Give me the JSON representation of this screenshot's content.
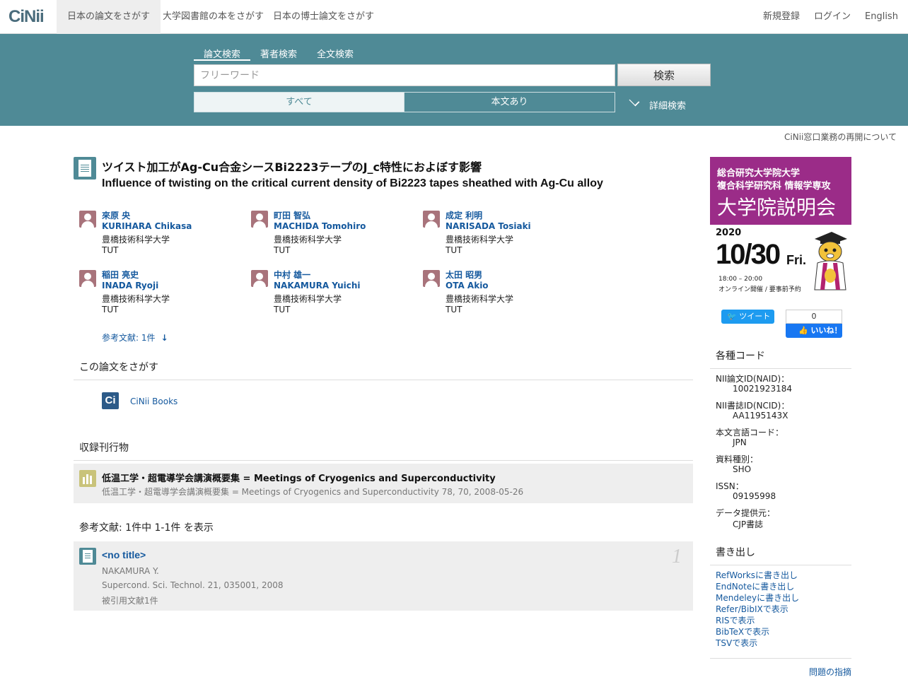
{
  "nav": {
    "logo_ci": "Ci",
    "logo_nii": "Nii",
    "tabs": [
      "日本の論文をさがす",
      "大学図書館の本をさがす",
      "日本の博士論文をさがす"
    ],
    "register": "新規登録",
    "login": "ログイン",
    "english": "English"
  },
  "search": {
    "tabs": [
      "論文検索",
      "著者検索",
      "全文検索"
    ],
    "placeholder": "フリーワード",
    "button": "検索",
    "filter_all": "すべて",
    "filter_body": "本文あり",
    "advanced": "詳細検索"
  },
  "notice": "CiNii窓口業務の再開について",
  "article": {
    "title_ja": "ツイスト加工がAg-Cu合金シースBi2223テープのJ_c特性におよぼす影響",
    "title_en": "Influence of twisting on the critical current density of Bi2223 tapes sheathed with Ag-Cu alloy",
    "authors": [
      {
        "ja": "來原 央",
        "en": "KURIHARA Chikasa",
        "aff_ja": "豊橋技術科学大学",
        "aff_en": "TUT"
      },
      {
        "ja": "町田 智弘",
        "en": "MACHIDA Tomohiro",
        "aff_ja": "豊橋技術科学大学",
        "aff_en": "TUT"
      },
      {
        "ja": "成定 利明",
        "en": "NARISADA Tosiaki",
        "aff_ja": "豊橋技術科学大学",
        "aff_en": "TUT"
      },
      {
        "ja": "稲田 亮史",
        "en": "INADA Ryoji",
        "aff_ja": "豊橋技術科学大学",
        "aff_en": "TUT"
      },
      {
        "ja": "中村 雄一",
        "en": "NAKAMURA Yuichi",
        "aff_ja": "豊橋技術科学大学",
        "aff_en": "TUT"
      },
      {
        "ja": "太田 昭男",
        "en": "OTA Akio",
        "aff_ja": "豊橋技術科学大学",
        "aff_en": "TUT"
      }
    ],
    "refs_link": "参考文献: 1件",
    "search_this_heading": "この論文をさがす",
    "cinii_books_icon": "Ci",
    "cinii_books": "CiNii Books",
    "journal_heading": "収録刊行物",
    "journal_title": "低温工学・超電導学会講演概要集 = Meetings of Cryogenics and Superconductivity",
    "journal_sub": "低温工学・超電導学会講演概要集 = Meetings of Cryogenics and Superconductivity 78, 70, 2008-05-26",
    "refs_heading": "参考文献:  1件中 1-1件 を表示",
    "ref": {
      "title": "<no title>",
      "num": "1",
      "author": "NAKAMURA Y.",
      "source": "Supercond. Sci. Technol. 21, 035001, 2008",
      "cited": "被引用文献1件"
    }
  },
  "banner": {
    "line1": "総合研究大学院大学",
    "line2": "複合科学研究科 情報学専攻",
    "line3": "大学院説明会",
    "year": "2020",
    "date": "10/30",
    "dow": "Fri.",
    "time": "18:00 – 20:00",
    "online": "オンライン開催 / 要事前予約"
  },
  "social": {
    "tweet": "ツイート",
    "fb_count": "0",
    "fb_like": "いいね！"
  },
  "codes": {
    "heading": "各種コード",
    "items": [
      {
        "label": "NII論文ID(NAID)：",
        "value": "10021923184"
      },
      {
        "label": "NII書誌ID(NCID)：",
        "value": "AA1195143X"
      },
      {
        "label": "本文言語コード：",
        "value": "JPN"
      },
      {
        "label": "資料種別：",
        "value": "SHO"
      },
      {
        "label": "ISSN：",
        "value": "09195998"
      },
      {
        "label": "データ提供元：",
        "value": "CJP書誌"
      }
    ]
  },
  "export": {
    "heading": "書き出し",
    "items": [
      "RefWorksに書き出し",
      "EndNoteに書き出し",
      "Mendeleyに書き出し",
      "Refer/BibIXで表示",
      "RISで表示",
      "BibTeXで表示",
      "TSVで表示"
    ]
  },
  "report": "問題の指摘",
  "colors": {
    "band": "#4f8a96",
    "link": "#15599e",
    "banner": "#9b2c88"
  }
}
